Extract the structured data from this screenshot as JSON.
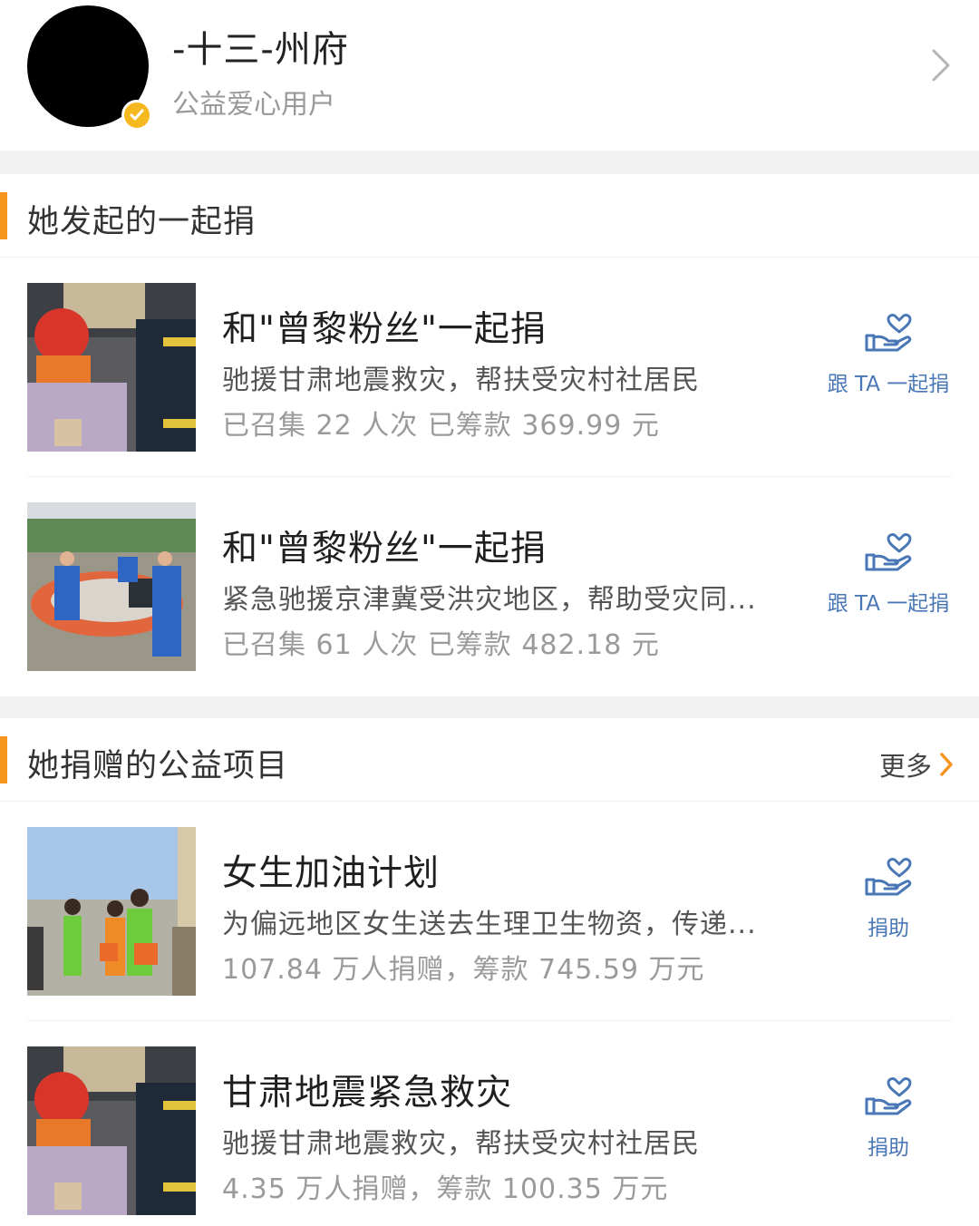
{
  "profile": {
    "name": "-十三-州府",
    "subtitle": "公益爱心用户"
  },
  "sections": {
    "initiated": {
      "title": "她发起的一起捐"
    },
    "donated": {
      "title": "她捐赠的公益项目",
      "more_label": "更多"
    }
  },
  "initiated_items": [
    {
      "title": "和\"曾黎粉丝\"一起捐",
      "description": "驰援甘肃地震救灾，帮扶受灾村社居民",
      "stats": "已召集 22 人次 已筹款 369.99 元",
      "action_label": "跟 TA 一起捐"
    },
    {
      "title": "和\"曾黎粉丝\"一起捐",
      "description": "紧急驰援京津冀受洪灾地区，帮助受灾同...",
      "stats": "已召集 61 人次 已筹款 482.18 元",
      "action_label": "跟 TA 一起捐"
    }
  ],
  "donated_items": [
    {
      "title": "女生加油计划",
      "description": "为偏远地区女生送去生理卫生物资，传递...",
      "stats": "107.84 万人捐赠，筹款 745.59 万元",
      "action_label": "捐助"
    },
    {
      "title": "甘肃地震紧急救灾",
      "description": "驰援甘肃地震救灾，帮扶受灾村社居民",
      "stats": "4.35 万人捐赠，筹款 100.35 万元",
      "action_label": "捐助"
    }
  ],
  "colors": {
    "accent_orange": "#f7941d",
    "action_blue": "#4a77b5",
    "badge_yellow": "#f6b81f"
  },
  "icons": {
    "verify": "verified-badge-icon",
    "chevron": "chevron-right-icon",
    "donate": "heart-hand-icon"
  }
}
